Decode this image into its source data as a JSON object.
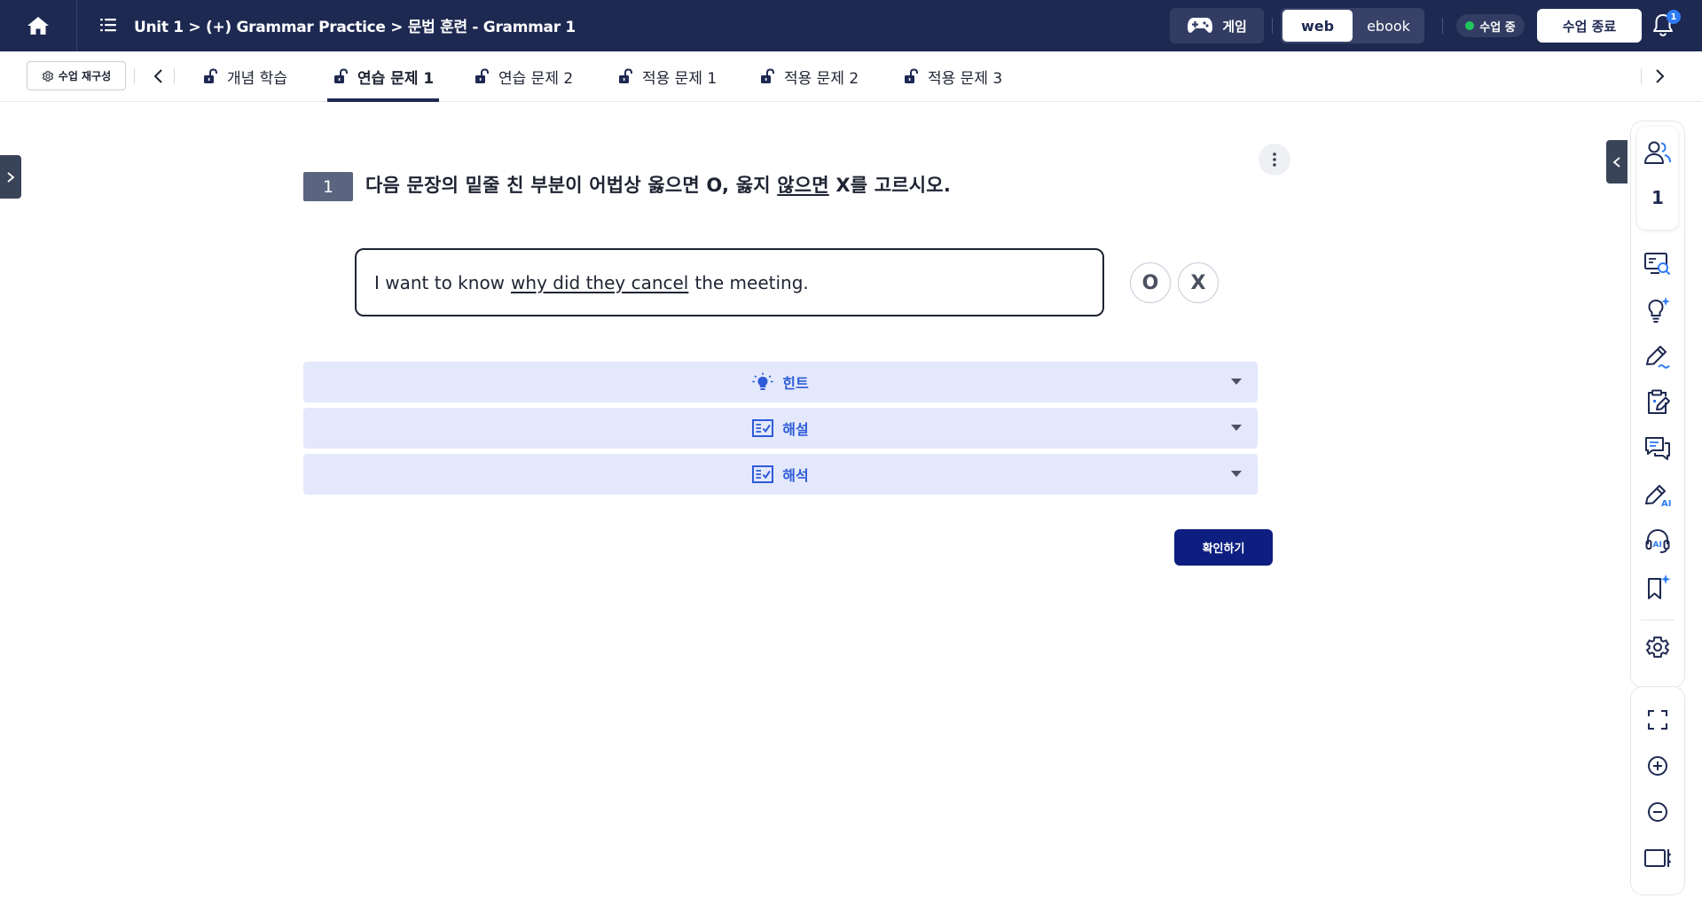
{
  "header": {
    "breadcrumb": "Unit 1 > (+) Grammar Practice > 문법 훈련 - Grammar 1",
    "game_label": "게임",
    "mode_web": "web",
    "mode_ebook": "ebook",
    "status_label": "수업 중",
    "end_class_label": "수업 종료",
    "notification_count": "1"
  },
  "tabbar": {
    "reorganize_label": "수업 재구성",
    "tabs": [
      {
        "label": "개념 학습",
        "active": false
      },
      {
        "label": "연습 문제 1",
        "active": true
      },
      {
        "label": "연습 문제 2",
        "active": false
      },
      {
        "label": "적용 문제 1",
        "active": false
      },
      {
        "label": "적용 문제 2",
        "active": false
      },
      {
        "label": "적용 문제 3",
        "active": false
      }
    ]
  },
  "question": {
    "number": "1",
    "text_before": "다음 문장의 밑줄 친 부분이 어법상 옳으면 O, 옳지 ",
    "text_underlined": "않으면",
    "text_after": " X를 고르시오.",
    "sentence_before": "I want to know",
    "sentence_underlined": "why did they cancel",
    "sentence_after": "the meeting.",
    "option_o": "O",
    "option_x": "X"
  },
  "accordions": {
    "hint": "힌트",
    "explanation": "해설",
    "translation": "해석"
  },
  "confirm_label": "확인하기",
  "sidebar_right": {
    "user_count": "1",
    "icons": [
      "users-icon",
      "screen-search-icon",
      "lightbulb-ai-icon",
      "pen-wave-icon",
      "clipboard-pen-icon",
      "chat-bubbles-icon",
      "pen-ai-icon",
      "headset-ai-icon",
      "bookmark-sparkle-icon",
      "settings-icon",
      "fullscreen-icon",
      "zoom-in-icon",
      "zoom-out-icon",
      "panel-toggle-icon"
    ]
  },
  "colors": {
    "header_bg": "#1e2952",
    "accent_blue": "#2e5bd8",
    "accordion_bg": "#e3e8fb",
    "confirm_bg": "#0d1e80",
    "status_green": "#22c55e"
  }
}
